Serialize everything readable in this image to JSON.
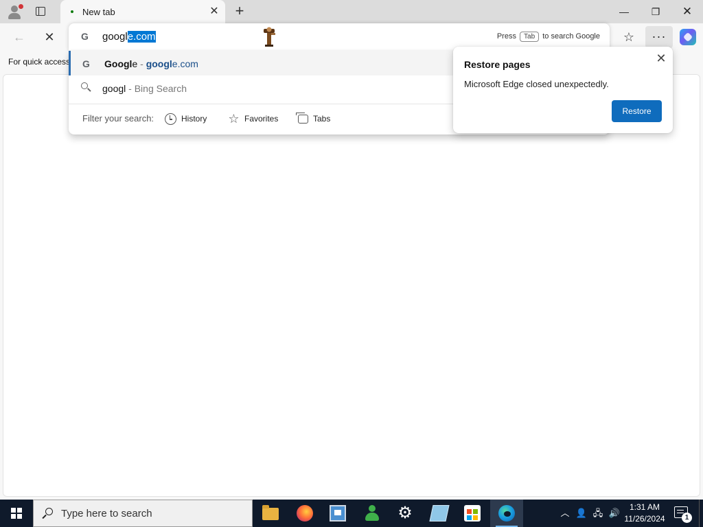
{
  "tab": {
    "title": "New tab"
  },
  "omnibox": {
    "typed_prefix": "googl",
    "autocomplete": "e.com",
    "hint_press": "Press",
    "hint_key": "Tab",
    "hint_suffix": "to search Google"
  },
  "favorites_bar": {
    "label": "For quick access"
  },
  "suggestions": [
    {
      "type": "site",
      "icon": "google-g-icon",
      "title_bold": "Googl",
      "title_rest": "e",
      "separator": " - ",
      "url_bold": "googl",
      "url_rest": "e.com"
    },
    {
      "type": "search",
      "icon": "search-icon",
      "query": "googl",
      "separator": " - ",
      "engine": "Bing Search"
    }
  ],
  "filter": {
    "label": "Filter your search:",
    "options": [
      "History",
      "Favorites",
      "Tabs"
    ]
  },
  "restore_popup": {
    "title": "Restore pages",
    "message": "Microsoft Edge closed unexpectedly.",
    "button": "Restore"
  },
  "taskbar": {
    "search_placeholder": "Type here to search",
    "apps": [
      "file-explorer-icon",
      "firefox-icon",
      "paint-icon",
      "people-icon",
      "settings-icon",
      "notepad-icon",
      "store-icon",
      "edge-icon"
    ],
    "time": "1:31 AM",
    "date": "11/26/2024",
    "notification_count": "1"
  },
  "colors": {
    "accent": "#0f6cbd",
    "selection": "#0078d4",
    "taskbar": "#0f1a2b",
    "tabstrip": "#dcdcdc"
  }
}
